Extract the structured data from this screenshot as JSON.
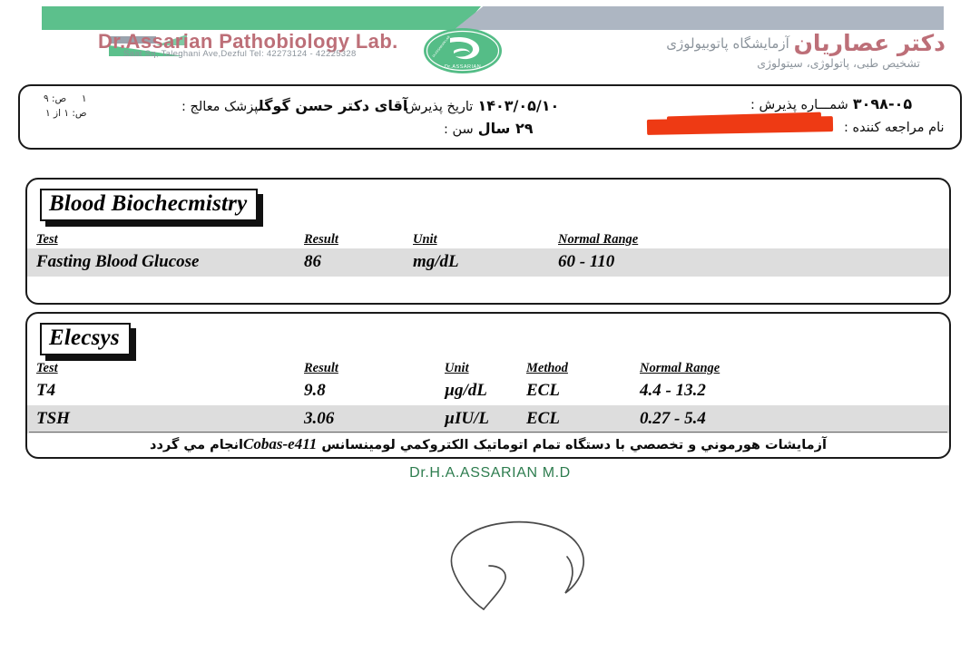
{
  "letterhead": {
    "lab_name_en": "Dr.Assarian Pathobiology Lab.",
    "lab_address_en": "Saat Sq, Taleghani Ave,Dezful Tel: 42273124 - 42225328",
    "lab_name_fa_prefix": "آزمایشگاه پاتوبیولوژی",
    "lab_name_fa_main": "دکتر عصاریان",
    "lab_services_fa": "تشخیص طبی، پاتولوژی، سیتولوژی",
    "logo_text": "Dr.ASSARIAN",
    "brand_green": "#5cc08c",
    "brand_gray": "#adb6c2",
    "brand_red": "#bd6f78"
  },
  "patient": {
    "page_line1": "ص: ۹",
    "page_line1_num": "۱",
    "page_line2": "ص: ۱ از ۱",
    "physician_label": "پزشک معالج :",
    "physician_value": "آقای دکتر حسن گوگل",
    "admission_date_label": "تاریخ پذیرش :",
    "admission_date_value": "۱۴۰۳/۰۵/۱۰",
    "age_label": "سن :",
    "age_value": "۲۹ سال",
    "admission_no_label": "شمـــاره پذیرش :",
    "admission_no_value": "۳۰۹۸-۰۵",
    "patient_name_label": "نام مراجعه کننده :",
    "patient_name_value": "",
    "redaction_color": "#ee3a14"
  },
  "panels": [
    {
      "title": "Blood Biochecmistry",
      "columns": [
        "Test",
        "Result",
        "Unit",
        "Normal Range"
      ],
      "rows": [
        {
          "test": "Fasting Blood Glucose",
          "result": "86",
          "unit": "mg/dL",
          "normal_range": "60 - 110"
        }
      ]
    },
    {
      "title": "Elecsys",
      "columns": [
        "Test",
        "Result",
        "Unit",
        "Method",
        "Normal Range"
      ],
      "rows": [
        {
          "test": "T4",
          "result": "9.8",
          "unit": "µg/dL",
          "method": "ECL",
          "normal_range": "4.4 - 13.2"
        },
        {
          "test": "TSH",
          "result": "3.06",
          "unit": "µIU/L",
          "method": "ECL",
          "normal_range": "0.27 - 5.4"
        }
      ],
      "footnote_fa_before": "آزمایشات هورموني و تخصصي با دستگاه تمام اتوماتیک الکتروکمي لومینسانس ",
      "footnote_device": "Cobas-e411",
      "footnote_fa_after": "انجام مي گردد"
    }
  ],
  "signature": {
    "name": "Dr.H.A.ASSARIAN  M.D",
    "color": "#2e7d4f"
  }
}
